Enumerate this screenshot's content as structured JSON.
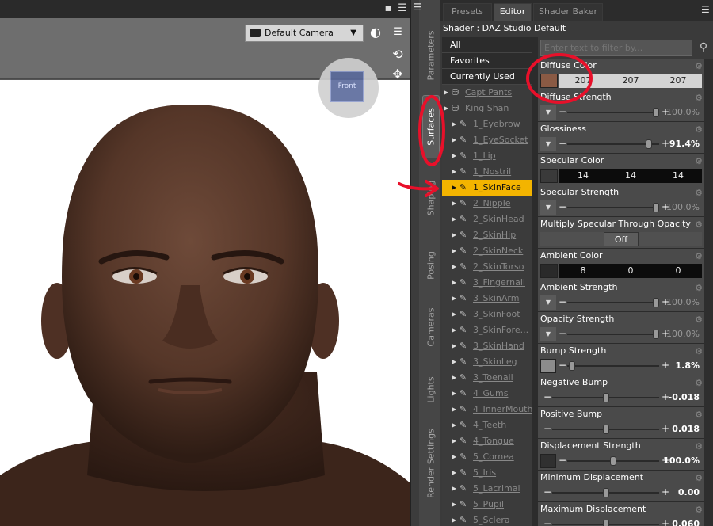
{
  "viewport": {
    "camera_label": "Default Camera",
    "cube_face_label": "Front"
  },
  "side_tabs": [
    "Parameters",
    "Surfaces",
    "Shaping",
    "Posing",
    "Cameras",
    "Lights",
    "Render Settings"
  ],
  "top_tabs": [
    "Presets",
    "Editor",
    "Shader Baker"
  ],
  "shader_label": "Shader : DAZ Studio Default",
  "tree": {
    "filters": [
      "All",
      "Favorites",
      "Currently Used"
    ],
    "figures": [
      "Capt Pants",
      "King Shan"
    ],
    "surfaces": [
      "1_Eyebrow",
      "1_EyeSocket",
      "1_Lip",
      "1_Nostril",
      "1_SkinFace",
      "2_Nipple",
      "2_SkinHead",
      "2_SkinHip",
      "2_SkinNeck",
      "2_SkinTorso",
      "3_Fingernail",
      "3_SkinArm",
      "3_SkinFoot",
      "3_SkinFore...",
      "3_SkinHand",
      "3_SkinLeg",
      "3_Toenail",
      "4_Gums",
      "4_InnerMouth",
      "4_Teeth",
      "4_Tongue",
      "5_Cornea",
      "5_Iris",
      "5_Lacrimal",
      "5_Pupil",
      "5_Sclera"
    ],
    "selected": "1_SkinFace"
  },
  "filter_placeholder": "Enter text to filter by...",
  "properties": {
    "diffuse_color": {
      "label": "Diffuse Color",
      "r": "207",
      "g": "207",
      "b": "207"
    },
    "diffuse_strength": {
      "label": "Diffuse Strength",
      "value": "100.0%",
      "level": 1.0
    },
    "glossiness": {
      "label": "Glossiness",
      "value": "91.4%",
      "level": 0.914
    },
    "specular_color": {
      "label": "Specular Color",
      "r": "14",
      "g": "14",
      "b": "14"
    },
    "specular_strength": {
      "label": "Specular Strength",
      "value": "100.0%",
      "level": 1.0
    },
    "multiply_specular": {
      "label": "Multiply Specular Through Opacity",
      "value": "Off"
    },
    "ambient_color": {
      "label": "Ambient Color",
      "r": "8",
      "g": "0",
      "b": "0"
    },
    "ambient_strength": {
      "label": "Ambient Strength",
      "value": "100.0%",
      "level": 1.0
    },
    "opacity_strength": {
      "label": "Opacity Strength",
      "value": "100.0%",
      "level": 1.0
    },
    "bump_strength": {
      "label": "Bump Strength",
      "value": "1.8%",
      "level": 0.018
    },
    "negative_bump": {
      "label": "Negative Bump",
      "value": "-0.018",
      "level": 0.5
    },
    "positive_bump": {
      "label": "Positive Bump",
      "value": "0.018",
      "level": 0.5
    },
    "displacement_strength": {
      "label": "Displacement Strength",
      "value": "100.0%",
      "level": 0.5
    },
    "minimum_displacement": {
      "label": "Minimum Displacement",
      "value": "0.00",
      "level": 0.5
    },
    "maximum_displacement": {
      "label": "Maximum Displacement",
      "value": "0.060",
      "level": 0.5
    }
  },
  "colors": {
    "selection": "#f3b400",
    "annotation": "#e8102a",
    "skin": "#5a3a2c"
  }
}
